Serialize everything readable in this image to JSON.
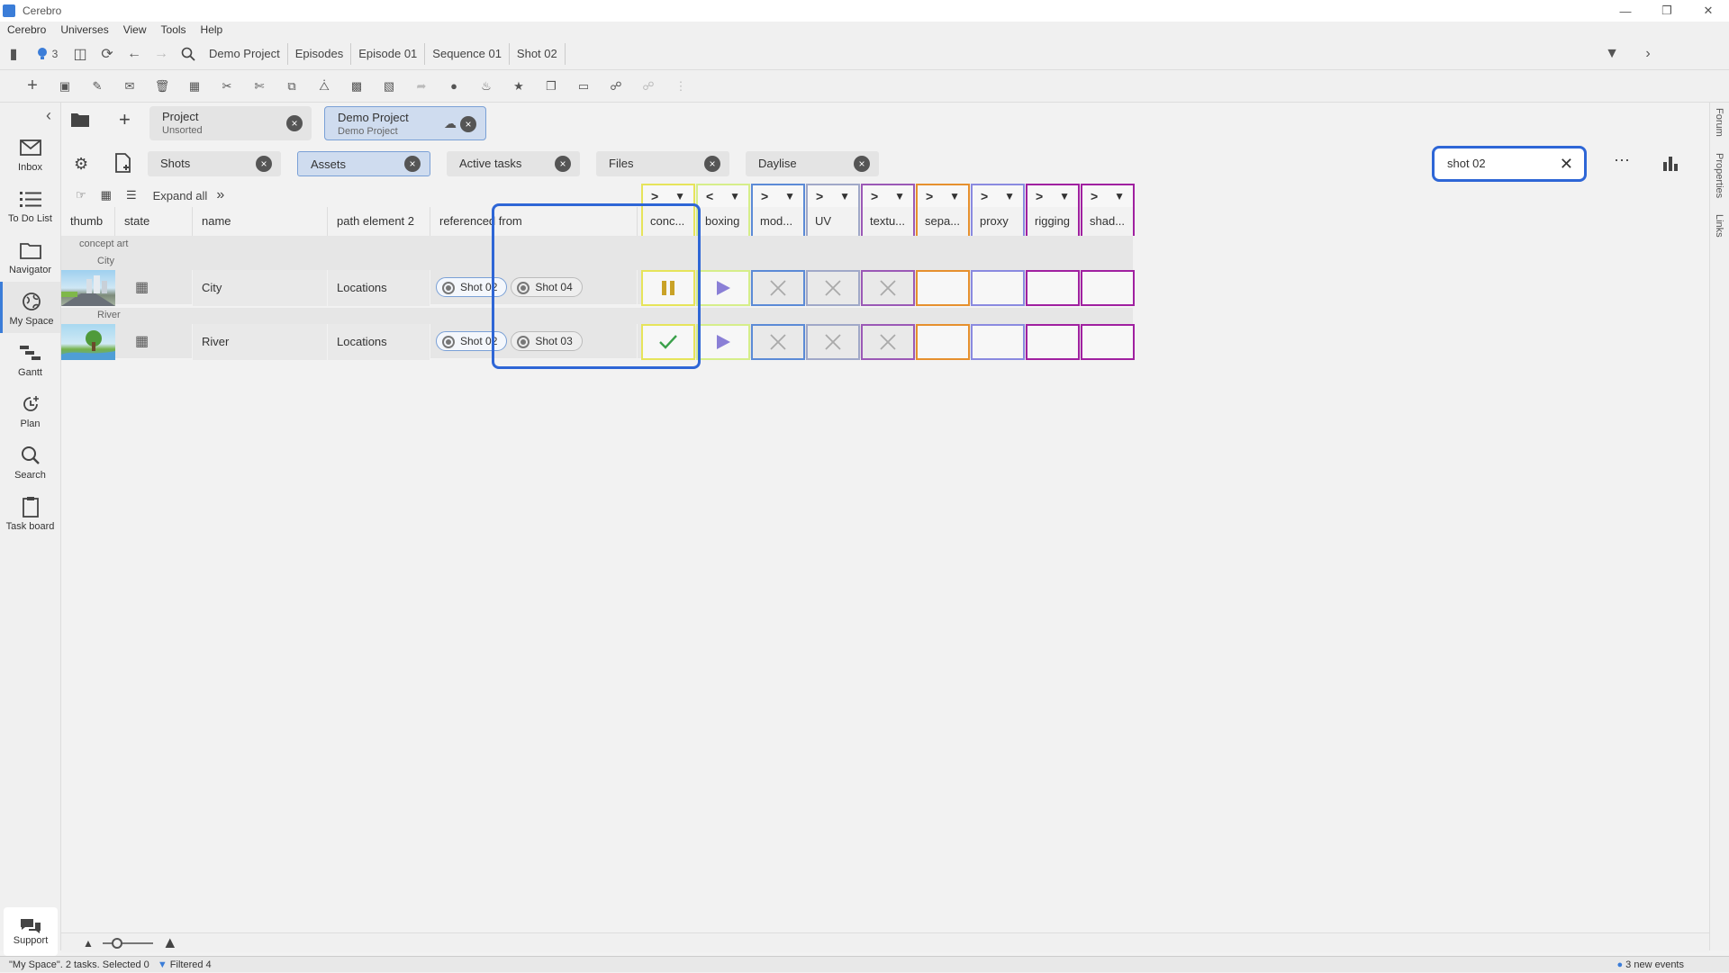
{
  "app": {
    "title": "Cerebro"
  },
  "menu": [
    "Cerebro",
    "Universes",
    "View",
    "Tools",
    "Help"
  ],
  "nav": {
    "notif_count": "3",
    "breadcrumbs": [
      "Demo Project",
      "Episodes",
      "Episode 01",
      "Sequence 01",
      "Shot 02"
    ]
  },
  "toolbar_icons": [
    "add",
    "add-subtask",
    "edit",
    "message",
    "delete",
    "archive",
    "cut",
    "cut-alt",
    "copy",
    "copy-alt",
    "paste",
    "paste-alt",
    "forward",
    "idea",
    "bell",
    "star",
    "duplicate",
    "move",
    "link",
    "unlink",
    "more-vertical"
  ],
  "leftnav": [
    {
      "label": "Inbox",
      "icon": "mail-icon"
    },
    {
      "label": "To Do List",
      "icon": "list-icon"
    },
    {
      "label": "Navigator",
      "icon": "folder-icon"
    },
    {
      "label": "My Space",
      "icon": "globe-icon"
    },
    {
      "label": "Gantt",
      "icon": "gantt-icon"
    },
    {
      "label": "Plan",
      "icon": "plan-icon"
    },
    {
      "label": "Search",
      "icon": "search-icon"
    },
    {
      "label": "Task board",
      "icon": "clipboard-icon"
    }
  ],
  "support_label": "Support",
  "rightrail": [
    "Forum",
    "Properties",
    "Links"
  ],
  "project_tabs": [
    {
      "title": "Project",
      "subtitle": "Unsorted"
    },
    {
      "title": "Demo Project",
      "subtitle": "Demo Project"
    }
  ],
  "filter_tabs": [
    "Shots",
    "Assets",
    "Active tasks",
    "Files",
    "Daylise"
  ],
  "search": {
    "value": "shot 02"
  },
  "grid": {
    "expand_all": "Expand all",
    "columns": [
      "thumb",
      "state",
      "name",
      "path element 2",
      "referenced from"
    ],
    "group": "concept art",
    "rows": [
      {
        "subgroup": "City",
        "name": "City",
        "path": "Locations",
        "refs": [
          "Shot 02",
          "Shot 04"
        ]
      },
      {
        "subgroup": "River",
        "name": "River",
        "path": "Locations",
        "refs": [
          "Shot 02",
          "Shot 03"
        ]
      }
    ],
    "task_columns": [
      {
        "label": "conc...",
        "color": "#e6e45a",
        "nav": ">"
      },
      {
        "label": "boxing",
        "color": "#d6ee8a",
        "nav": "<"
      },
      {
        "label": "mod...",
        "color": "#5b8ad6",
        "nav": ">"
      },
      {
        "label": "UV",
        "color": "#a0a8c8",
        "nav": ">"
      },
      {
        "label": "textu...",
        "color": "#9b59b6",
        "nav": ">"
      },
      {
        "label": "sepa...",
        "color": "#e6902e",
        "nav": ">"
      },
      {
        "label": "proxy",
        "color": "#8a8ae0",
        "nav": ">"
      },
      {
        "label": "rigging",
        "color": "#a020a0",
        "nav": ">"
      },
      {
        "label": "shad...",
        "color": "#a020a0",
        "nav": ">"
      }
    ],
    "task_states": [
      [
        "paused",
        "play",
        "x",
        "x",
        "x",
        "empty",
        "empty",
        "empty",
        "empty"
      ],
      [
        "check",
        "play",
        "x",
        "x",
        "x",
        "empty",
        "empty",
        "empty",
        "empty"
      ]
    ]
  },
  "status": {
    "left": "\"My Space\". 2 tasks. Selected 0",
    "filtered": "Filtered 4",
    "right": "3 new events"
  }
}
